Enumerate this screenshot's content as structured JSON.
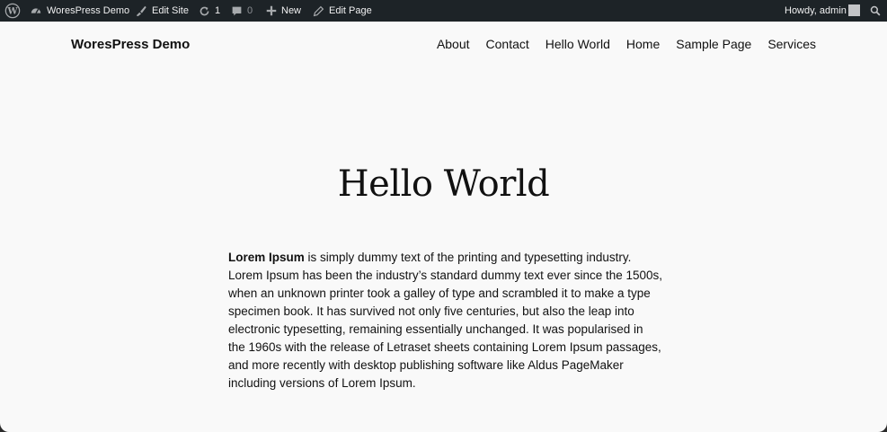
{
  "adminbar": {
    "site_name": "WoresPress Demo",
    "edit_site": "Edit Site",
    "updates_count": "1",
    "comments_count": "0",
    "new_label": "New",
    "edit_page": "Edit Page",
    "howdy": "Howdy, admin",
    "icons": {
      "wp": "wordpress-logo-icon",
      "site": "dashboard-icon",
      "edit_site": "brush-icon",
      "updates": "refresh-icon",
      "comments": "comment-icon",
      "new": "plus-icon",
      "edit_page": "pencil-icon",
      "search": "search-icon"
    }
  },
  "header": {
    "site_title": "WoresPress Demo",
    "nav": [
      {
        "label": "About"
      },
      {
        "label": "Contact"
      },
      {
        "label": "Hello World"
      },
      {
        "label": "Home"
      },
      {
        "label": "Sample Page"
      },
      {
        "label": "Services"
      }
    ]
  },
  "content": {
    "heading": "Hello World",
    "paragraph_bold": "Lorem Ipsum",
    "paragraph_rest": " is simply dummy text of the printing and typesetting industry. Lorem Ipsum has been the industry’s standard dummy text ever since the 1500s, when an unknown printer took a galley of type and scrambled it to make a type specimen book. It has survived not only five centuries, but also the leap into electronic typesetting, remaining essentially unchanged. It was popularised in the 1960s with the release of Letraset sheets containing Lorem Ipsum passages, and more recently with desktop publishing software like Aldus PageMaker including versions of Lorem Ipsum."
  },
  "colors": {
    "adminbar_bg": "#1d2327",
    "page_bg": "#f9f9f9",
    "text": "#111111"
  }
}
